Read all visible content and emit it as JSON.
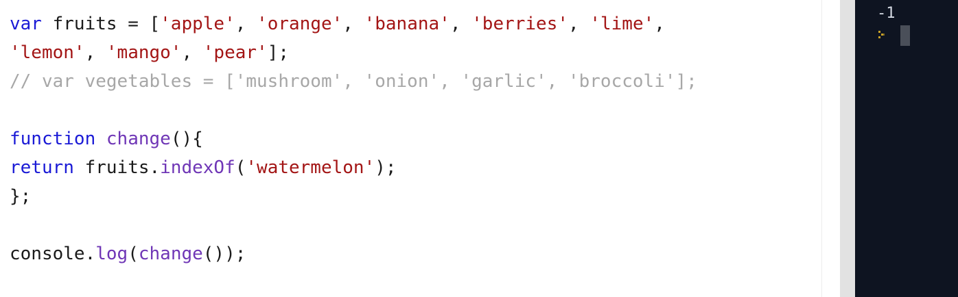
{
  "editor": {
    "lines": [
      [
        {
          "t": "var",
          "c": "kw"
        },
        {
          "t": " fruits = [",
          "c": ""
        },
        {
          "t": "'apple'",
          "c": "str"
        },
        {
          "t": ", ",
          "c": ""
        },
        {
          "t": "'orange'",
          "c": "str"
        },
        {
          "t": ", ",
          "c": ""
        },
        {
          "t": "'banana'",
          "c": "str"
        },
        {
          "t": ", ",
          "c": ""
        },
        {
          "t": "'berries'",
          "c": "str"
        },
        {
          "t": ", ",
          "c": ""
        },
        {
          "t": "'lime'",
          "c": "str"
        },
        {
          "t": ",",
          "c": ""
        }
      ],
      [
        {
          "t": "'lemon'",
          "c": "str"
        },
        {
          "t": ", ",
          "c": ""
        },
        {
          "t": "'mango'",
          "c": "str"
        },
        {
          "t": ", ",
          "c": ""
        },
        {
          "t": "'pear'",
          "c": "str"
        },
        {
          "t": "];",
          "c": ""
        }
      ],
      [
        {
          "t": "// var vegetables = ['mushroom', 'onion', 'garlic', 'broccoli'];",
          "c": "cm"
        }
      ],
      [],
      [
        {
          "t": "function",
          "c": "kw"
        },
        {
          "t": " ",
          "c": ""
        },
        {
          "t": "change",
          "c": "fn"
        },
        {
          "t": "(){",
          "c": ""
        }
      ],
      [
        {
          "t": "return",
          "c": "kw"
        },
        {
          "t": " fruits.",
          "c": ""
        },
        {
          "t": "indexOf",
          "c": "fn"
        },
        {
          "t": "(",
          "c": ""
        },
        {
          "t": "'watermelon'",
          "c": "str"
        },
        {
          "t": ");",
          "c": ""
        }
      ],
      [
        {
          "t": "};",
          "c": ""
        }
      ],
      [],
      [
        {
          "t": "console.",
          "c": ""
        },
        {
          "t": "log",
          "c": "fn"
        },
        {
          "t": "(",
          "c": ""
        },
        {
          "t": "change",
          "c": "fn"
        },
        {
          "t": "());",
          "c": ""
        }
      ]
    ]
  },
  "console": {
    "output": "-1",
    "prompt_icon": "chevron-right-icon",
    "colors": {
      "background": "#0e1421",
      "prompt": "#c9a227",
      "cursor": "#4a4f59"
    }
  },
  "colors": {
    "keyword": "#1a1ad6",
    "function": "#6f36b6",
    "string": "#a31515",
    "comment": "#a7a7a7",
    "text": "#1a1a1a"
  }
}
